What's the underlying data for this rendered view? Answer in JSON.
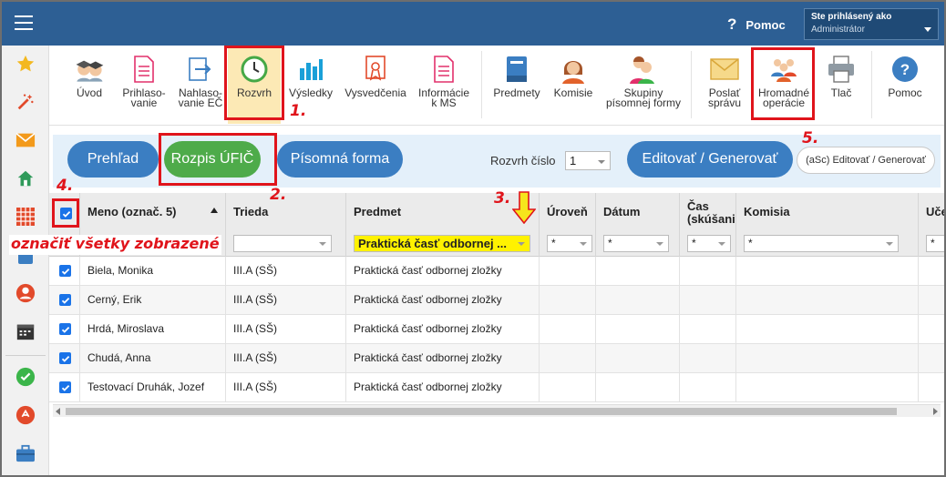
{
  "topbar": {
    "help_label": "Pomoc",
    "help_icon": "question-mark-icon",
    "user_caption": "Ste prihlásený ako",
    "user_role": "Administrátor"
  },
  "sidebar": {
    "icons": [
      "star-icon",
      "magic-wand-icon",
      "envelope-icon",
      "home-icon",
      "grid-icon",
      "book-icon",
      "person-icon",
      "calendar-clock-icon",
      "check-circle-icon",
      "medal-icon",
      "briefcase-icon"
    ]
  },
  "toolbar": {
    "items": [
      {
        "label": "Úvod",
        "icon": "graduates-icon"
      },
      {
        "label": "Prihlaso-\nvanie",
        "icon": "document-list-icon"
      },
      {
        "label": "Nahlaso-\nvanie EČ",
        "icon": "arrow-export-icon"
      },
      {
        "label": "Rozvrh",
        "icon": "clock-icon"
      },
      {
        "label": "Výsledky",
        "icon": "bar-chart-icon"
      },
      {
        "label": "Vysvedčenia",
        "icon": "certificate-icon"
      },
      {
        "label": "Informácie\nk MS",
        "icon": "info-document-icon"
      },
      {
        "label": "Predmety",
        "icon": "book-icon"
      },
      {
        "label": "Komisie",
        "icon": "woman-avatar-icon"
      },
      {
        "label": "Skupiny\npísomnej formy",
        "icon": "group-people-icon"
      },
      {
        "label": "Poslať\nsprávu",
        "icon": "envelope-icon"
      },
      {
        "label": "Hromadné\noperácie",
        "icon": "team-icon"
      },
      {
        "label": "Tlač",
        "icon": "printer-icon"
      },
      {
        "label": "Pomoc",
        "icon": "help-circle-icon"
      }
    ]
  },
  "tabs": {
    "prehlad": "Prehľad",
    "rozpis": "Rozpis ÚFIČ",
    "pisomna": "Písomná forma",
    "rozvrh_cislo_label": "Rozvrh číslo",
    "rozvrh_cislo_value": "1",
    "edit_generate": "Editovať / Generovať",
    "asc_edit_generate": "(aSc) Editovať / Generovať"
  },
  "grid": {
    "columns": [
      "Meno (označ. 5)",
      "Trieda",
      "Predmet",
      "Úroveň",
      "Dátum",
      "Čas\n(skúšani",
      "Komisia",
      "Učeb"
    ],
    "filters": {
      "predmet": "Praktická časť odbornej ...",
      "uroven": "*",
      "datum": "*",
      "cas": "*",
      "komisia": "*",
      "uceb": "*"
    },
    "rows": [
      {
        "meno": "Biela, Monika",
        "trieda": "III.A (SŠ)",
        "predmet": "Praktická časť odbornej zložky"
      },
      {
        "meno": "Cerný, Erik",
        "trieda": "III.A (SŠ)",
        "predmet": "Praktická časť odbornej zložky"
      },
      {
        "meno": "Hrdá, Miroslava",
        "trieda": "III.A (SŠ)",
        "predmet": "Praktická časť odbornej zložky"
      },
      {
        "meno": "Chudá, Anna",
        "trieda": "III.A (SŠ)",
        "predmet": "Praktická časť odbornej zložky"
      },
      {
        "meno": "Testovací Druhák, Jozef",
        "trieda": "III.A (SŠ)",
        "predmet": "Praktická časť odbornej zložky"
      }
    ]
  },
  "annotations": {
    "n1": "1.",
    "n2": "2.",
    "n3": "3.",
    "n4": "4.",
    "n5": "5.",
    "select_all_note": "označiť všetky zobrazené"
  },
  "colors": {
    "topbar": "#2d5f94",
    "accent_blue": "#3b7ec2",
    "accent_green": "#4eab4a",
    "highlight_red": "#e0141b",
    "filter_yellow": "#fff200"
  }
}
